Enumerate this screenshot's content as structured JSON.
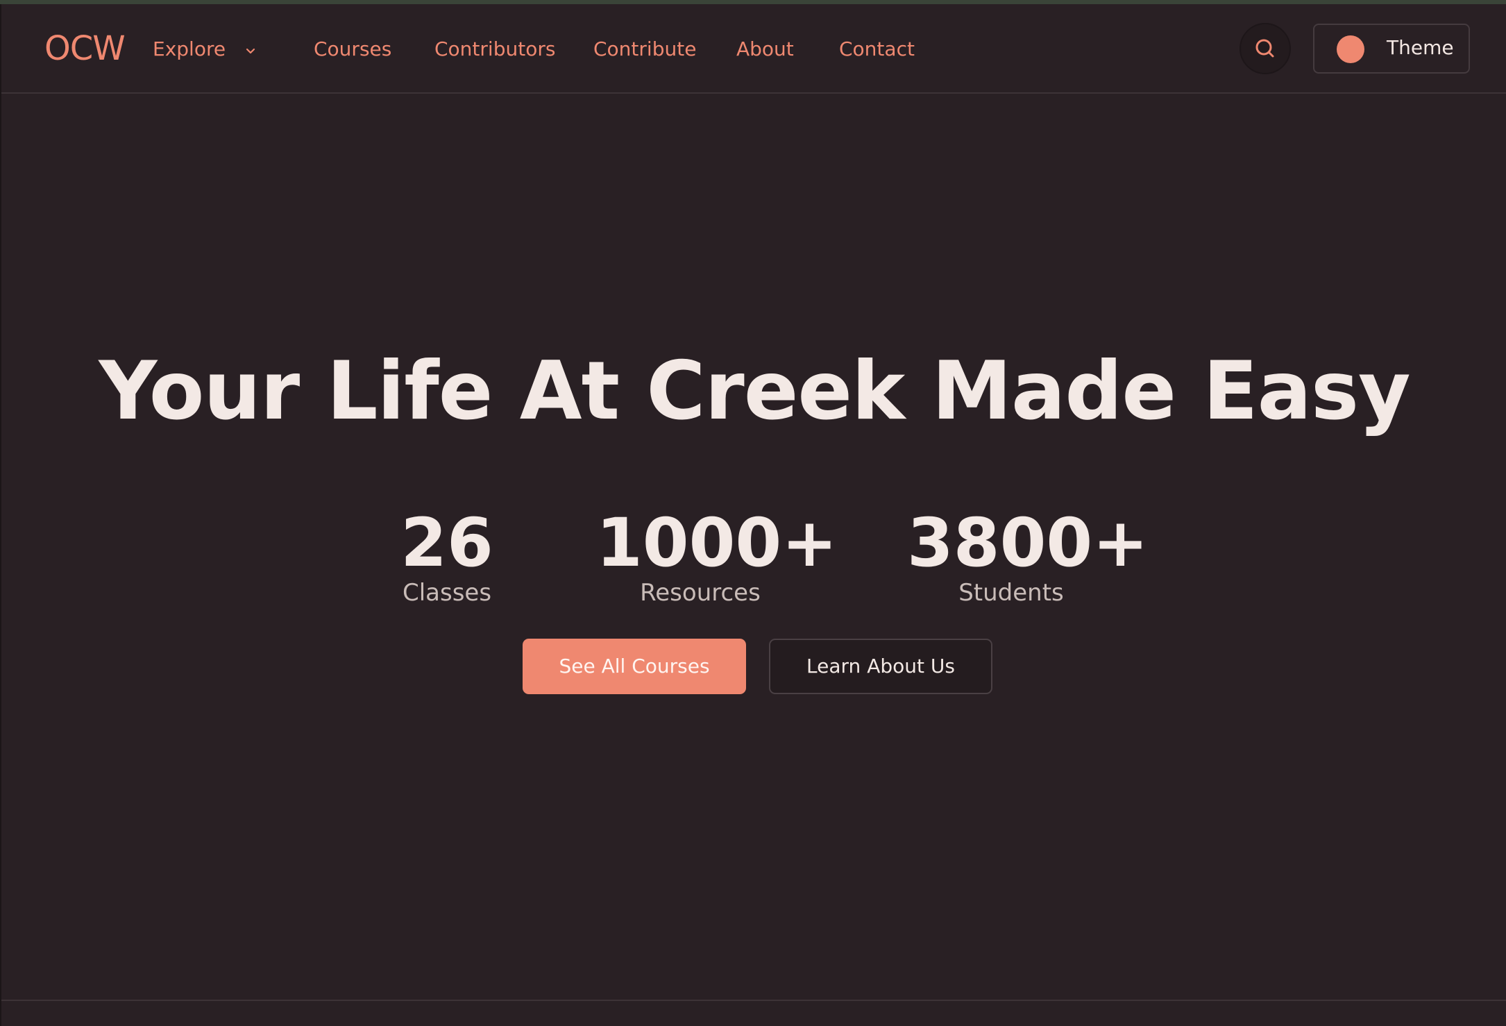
{
  "colors": {
    "background": "#292024",
    "accent": "#ef8870",
    "text_primary": "#f3e9e5",
    "text_secondary": "#c9bcb8"
  },
  "navbar": {
    "logo": "OCW",
    "explore_label": "Explore",
    "links": [
      {
        "label": "Courses"
      },
      {
        "label": "Contributors"
      },
      {
        "label": "Contribute"
      },
      {
        "label": "About"
      },
      {
        "label": "Contact"
      }
    ],
    "search_icon": "search-icon",
    "theme_label": "Theme"
  },
  "hero": {
    "title": "Your Life At Creek Made Easy",
    "stats": [
      {
        "value": "26",
        "label": "Classes"
      },
      {
        "value": "1000+",
        "label": "Resources"
      },
      {
        "value": "3800+",
        "label": "Students"
      }
    ],
    "primary_button": "See All Courses",
    "secondary_button": "Learn About Us"
  }
}
